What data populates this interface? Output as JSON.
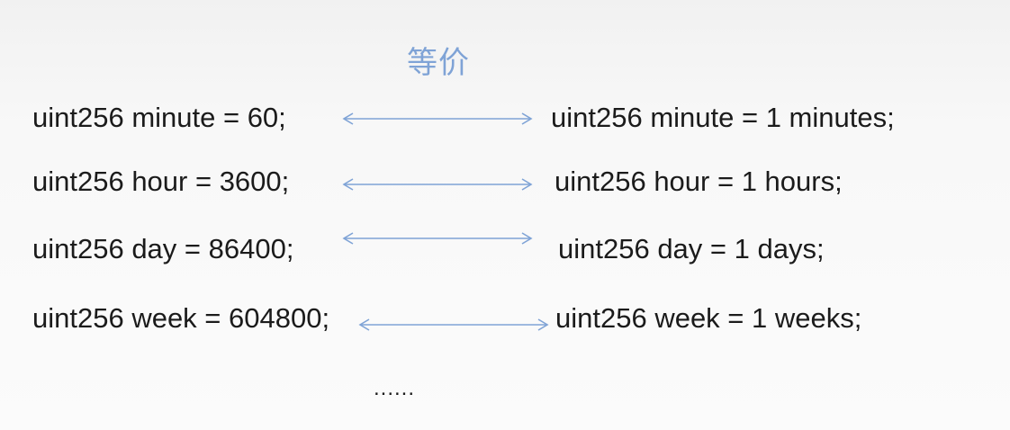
{
  "slide": {
    "heading": "等价",
    "rows": [
      {
        "left": "uint256 minute = 60;",
        "right": "uint256 minute = 1 minutes;"
      },
      {
        "left": "uint256 hour = 3600;",
        "right": "uint256 hour = 1 hours;"
      },
      {
        "left": "uint256 day = 86400;",
        "right": "uint256 day = 1 days;"
      },
      {
        "left": "uint256 week = 604800;",
        "right": "uint256 week = 1 weeks;"
      }
    ],
    "ellipsis": "......"
  },
  "colors": {
    "heading": "#7fa3d6",
    "arrow": "#7fa3d6",
    "text": "#1b1b1b"
  }
}
